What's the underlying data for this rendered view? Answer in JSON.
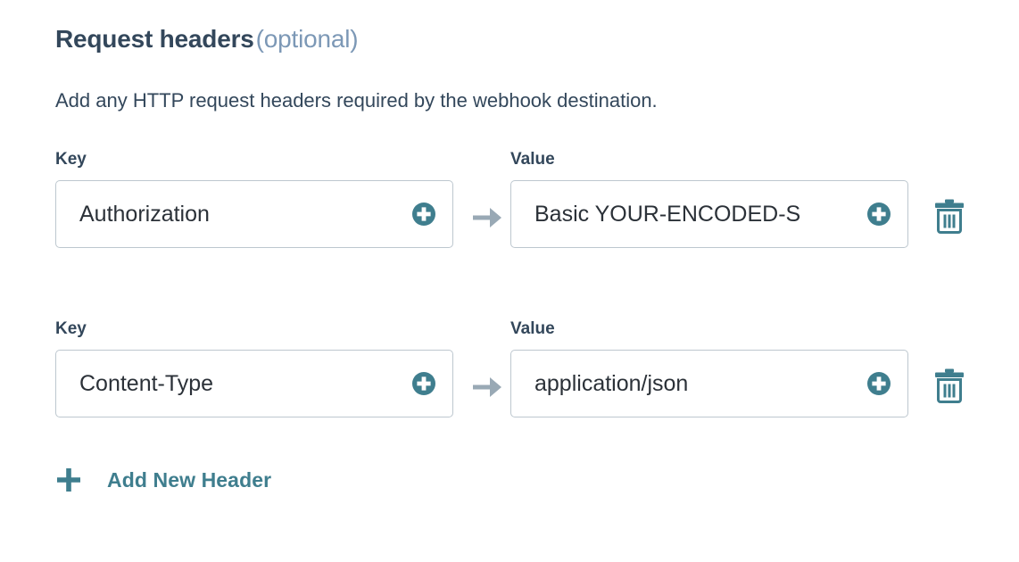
{
  "section": {
    "title": "Request headers",
    "optional_suffix": "(optional)",
    "description": "Add any HTTP request headers required by the webhook destination."
  },
  "labels": {
    "key": "Key",
    "value": "Value"
  },
  "icons": {
    "key_plus": "circle-plus-icon",
    "value_plus": "circle-plus-icon",
    "arrow": "arrow-right-icon",
    "delete": "trash-icon",
    "add": "plus-icon"
  },
  "colors": {
    "accent_teal": "#3f7e8e",
    "border_gray": "#bdc7cf",
    "arrow_gray": "#99a9b5",
    "text_dark": "#33475b",
    "text_muted": "#7c98b6"
  },
  "rows": [
    {
      "key_label": "Key",
      "key_value": "Authorization",
      "value_label": "Value",
      "value_value": "Basic YOUR-ENCODED-S"
    },
    {
      "key_label": "Key",
      "key_value": "Content-Type",
      "value_label": "Value",
      "value_value": "application/json"
    }
  ],
  "add_new": {
    "label": "Add New Header"
  }
}
